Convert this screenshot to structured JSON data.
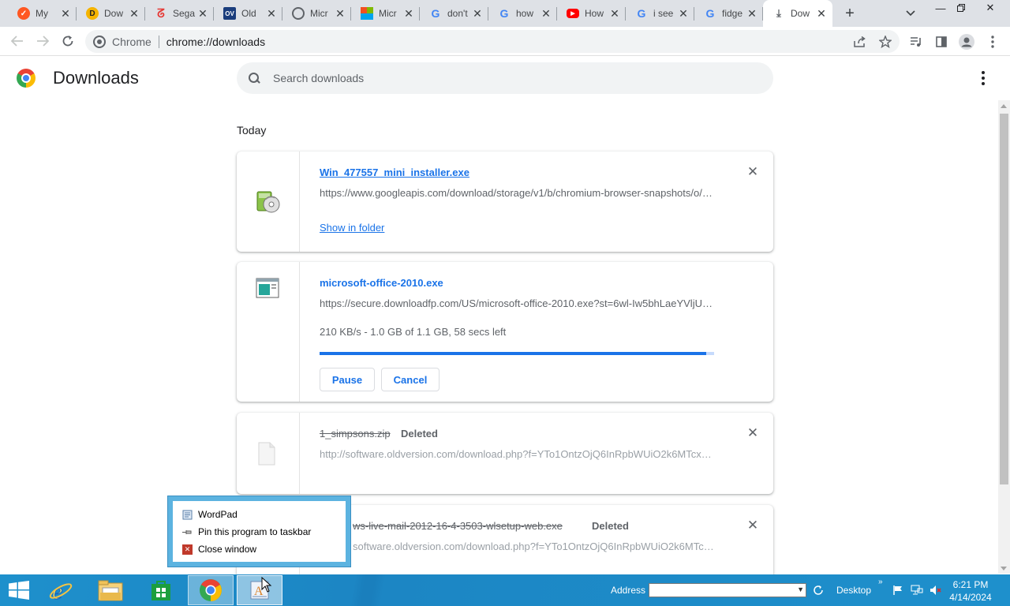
{
  "tabs": [
    {
      "title": "My",
      "favicon": "multi-app-icon",
      "color": "#ff5722"
    },
    {
      "title": "Dow",
      "favicon": "circle-d-icon",
      "color": "#f5b400"
    },
    {
      "title": "Sega",
      "favicon": "red-swoosh-icon",
      "color": "#e53935"
    },
    {
      "title": "Old",
      "favicon": "ov-icon",
      "color": "#1a3d7c"
    },
    {
      "title": "Micr",
      "favicon": "globe-icon",
      "color": "#5f6368"
    },
    {
      "title": "Micr",
      "favicon": "windows-logo-icon",
      "color": "#f25022"
    },
    {
      "title": "don't",
      "favicon": "google-icon",
      "color": "#4285f4"
    },
    {
      "title": "how",
      "favicon": "google-icon",
      "color": "#4285f4"
    },
    {
      "title": "How",
      "favicon": "youtube-icon",
      "color": "#ff0000"
    },
    {
      "title": "i see",
      "favicon": "google-icon",
      "color": "#4285f4"
    },
    {
      "title": "fidge",
      "favicon": "google-icon",
      "color": "#4285f4"
    },
    {
      "title": "Dow",
      "favicon": "download-icon",
      "color": "#5f6368",
      "active": true
    }
  ],
  "toolbar": {
    "chip": "Chrome",
    "url": "chrome://downloads"
  },
  "page": {
    "title": "Downloads",
    "search_placeholder": "Search downloads",
    "section_date": "Today"
  },
  "downloads": [
    {
      "filename": "Win_477557_mini_installer.exe",
      "url": "https://www.googleapis.com/download/storage/v1/b/chromium-browser-snapshots/o/Win%2F477557%2Fmini_installer.exe",
      "action": "Show in folder",
      "icon": "installer-cd-icon"
    },
    {
      "filename": "microsoft-office-2010.exe",
      "url": "https://secure.downloadfp.com/US/microsoft-office-2010.exe?st=6wl-Iw5bhLaeYVljUHCq",
      "progress_text": "210 KB/s - 1.0 GB of 1.1 GB, 58 secs left",
      "progress": 0.98,
      "buttons": {
        "pause": "Pause",
        "cancel": "Cancel"
      },
      "icon": "window-app-icon"
    },
    {
      "filename": "1_simpsons.zip",
      "status": "Deleted",
      "url": "http://software.oldversion.com/download.php?f=YTo1OntzOjQ6InRpbWUiO2k6MTcxMzEwMDcwMjt",
      "icon": "blank-file-icon"
    },
    {
      "filename": "windows-live-mail-2012-16-4-3503-wlsetup-web.exe",
      "filename_visible": "ws-live-mail-2012-16-4-3503-wlsetup-web.exe",
      "status": "Deleted",
      "url": "http://software.oldversion.com/download.php?f=YTo1OntzOjQ6InRpbWUiO2k6MTcxMzEwMDcwMjt",
      "url_visible": "software.oldversion.com/download.php?f=YTo1OntzOjQ6InRpbWUiO2k6MTcxMzEwMDcwMjt"
    }
  ],
  "jumplist": {
    "items": [
      "WordPad",
      "Pin this program to taskbar",
      "Close window"
    ]
  },
  "taskbar": {
    "address_label": "Address",
    "desktop_label": "Desktop",
    "time": "6:21 PM",
    "date": "4/14/2024",
    "apps": [
      "internet-explorer-icon",
      "file-explorer-icon",
      "store-icon",
      "chrome-icon",
      "wordpad-icon"
    ]
  },
  "colors": {
    "accent": "#1a73e8",
    "taskbar": "#1e90cc"
  }
}
